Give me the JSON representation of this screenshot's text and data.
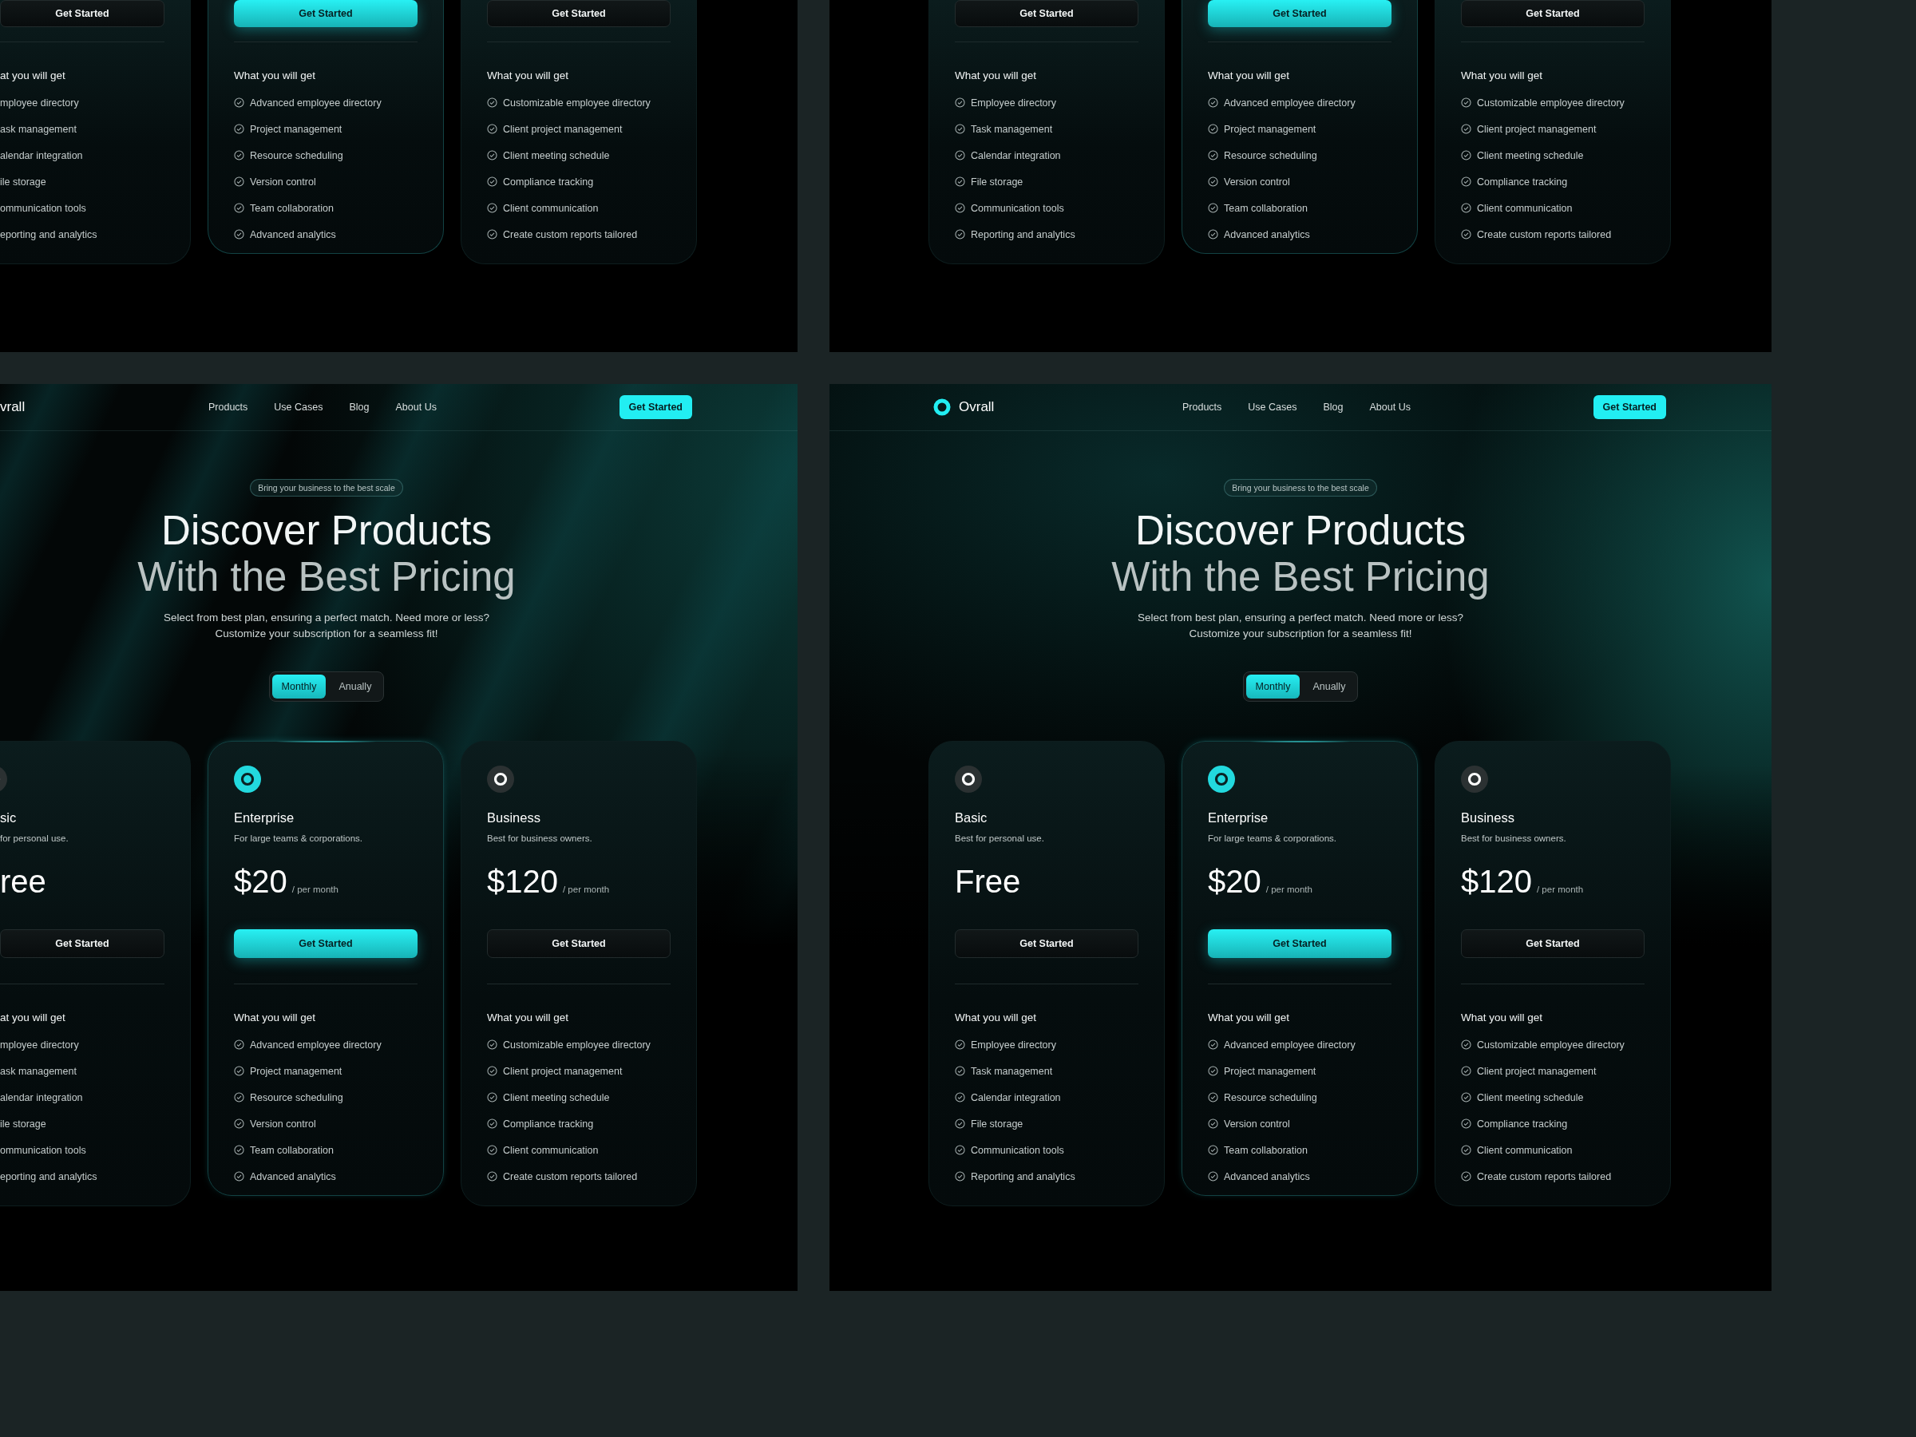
{
  "panels": [
    {
      "kind": "cards-cropped",
      "cards": [
        {
          "featured": false,
          "clipped": true,
          "button": "Get Started",
          "features_title": "at you will get",
          "features": [
            "mployee directory",
            "ask management",
            "alendar integration",
            "ile storage",
            "ommunication tools",
            "eporting and analytics"
          ]
        },
        {
          "featured": true,
          "clipped": false,
          "button": "Get Started",
          "features_title": "What you will get",
          "features": [
            "Advanced employee directory",
            "Project management",
            "Resource scheduling",
            "Version control",
            "Team collaboration",
            "Advanced analytics"
          ]
        },
        {
          "featured": false,
          "clipped": false,
          "button": "Get Started",
          "features_title": "What you will get",
          "features": [
            "Customizable employee directory",
            "Client project management",
            "Client meeting schedule",
            "Compliance tracking",
            "Client communication",
            "Create custom reports tailored"
          ]
        }
      ]
    },
    {
      "kind": "cards",
      "cards": [
        {
          "featured": false,
          "clipped": false,
          "button": "Get Started",
          "features_title": "What you will get",
          "features": [
            "Employee directory",
            "Task management",
            "Calendar integration",
            "File storage",
            "Communication tools",
            "Reporting and analytics"
          ]
        },
        {
          "featured": true,
          "clipped": false,
          "button": "Get Started",
          "features_title": "What you will get",
          "features": [
            "Advanced employee directory",
            "Project management",
            "Resource scheduling",
            "Version control",
            "Team collaboration",
            "Advanced analytics"
          ]
        },
        {
          "featured": false,
          "clipped": false,
          "button": "Get Started",
          "features_title": "What you will get",
          "features": [
            "Customizable employee directory",
            "Client project management",
            "Client meeting schedule",
            "Compliance tracking",
            "Client communication",
            "Create custom reports tailored"
          ]
        }
      ]
    },
    {
      "kind": "page-cropped",
      "nav": {
        "logo_mark": false,
        "logo": "vrall",
        "links": [
          "Products",
          "Use Cases",
          "Blog",
          "About Us"
        ],
        "cta": "Get Started"
      },
      "hero": {
        "badge": "Bring your business to the best scale",
        "title_lines": [
          "Discover Products",
          "With the Best Pricing"
        ],
        "subtitle_lines": [
          "Select from best plan, ensuring a perfect match. Need more or less?",
          "Customize your subscription for a seamless fit!"
        ],
        "toggle": [
          {
            "label": "Monthly",
            "selected": true
          },
          {
            "label": "Anually",
            "selected": false
          }
        ]
      },
      "cards": [
        {
          "featured": false,
          "clipped": true,
          "name": "sic",
          "description": "for personal use.",
          "price": "ree",
          "button": "Get Started",
          "features_title": "at you will get",
          "features": [
            "mployee directory",
            "ask management",
            "alendar integration",
            "ile storage",
            "ommunication tools",
            "eporting and analytics"
          ]
        },
        {
          "featured": true,
          "clipped": false,
          "name": "Enterprise",
          "description": "For large teams & corporations.",
          "price": "$20",
          "period": "/ per month",
          "button": "Get Started",
          "features_title": "What you will get",
          "features": [
            "Advanced employee directory",
            "Project management",
            "Resource scheduling",
            "Version control",
            "Team collaboration",
            "Advanced analytics"
          ]
        },
        {
          "featured": false,
          "clipped": false,
          "name": "Business",
          "description": "Best for business owners.",
          "price": "$120",
          "period": "/ per month",
          "button": "Get Started",
          "features_title": "What you will get",
          "features": [
            "Customizable employee directory",
            "Client project management",
            "Client meeting schedule",
            "Compliance tracking",
            "Client communication",
            "Create custom reports tailored"
          ]
        }
      ]
    },
    {
      "kind": "page",
      "nav": {
        "logo_mark": true,
        "logo": "Ovrall",
        "links": [
          "Products",
          "Use Cases",
          "Blog",
          "About Us"
        ],
        "cta": "Get Started"
      },
      "hero": {
        "badge": "Bring your business to the best scale",
        "title_lines": [
          "Discover Products",
          "With the Best Pricing"
        ],
        "subtitle_lines": [
          "Select from best plan, ensuring a perfect match. Need more or less?",
          "Customize your subscription for a seamless fit!"
        ],
        "toggle": [
          {
            "label": "Monthly",
            "selected": true
          },
          {
            "label": "Anually",
            "selected": false
          }
        ]
      },
      "cards": [
        {
          "featured": false,
          "clipped": false,
          "name": "Basic",
          "description": "Best for personal use.",
          "price": "Free",
          "button": "Get Started",
          "features_title": "What you will get",
          "features": [
            "Employee directory",
            "Task management",
            "Calendar integration",
            "File storage",
            "Communication tools",
            "Reporting and analytics"
          ]
        },
        {
          "featured": true,
          "clipped": false,
          "name": "Enterprise",
          "description": "For large teams & corporations.",
          "price": "$20",
          "period": "/ per month",
          "button": "Get Started",
          "features_title": "What you will get",
          "features": [
            "Advanced employee directory",
            "Project management",
            "Resource scheduling",
            "Version control",
            "Team collaboration",
            "Advanced analytics"
          ]
        },
        {
          "featured": false,
          "clipped": false,
          "name": "Business",
          "description": "Best for business owners.",
          "price": "$120",
          "period": "/ per month",
          "button": "Get Started",
          "features_title": "What you will get",
          "features": [
            "Customizable employee directory",
            "Client project management",
            "Client meeting schedule",
            "Compliance tracking",
            "Client communication",
            "Create custom reports tailored"
          ]
        }
      ]
    }
  ]
}
